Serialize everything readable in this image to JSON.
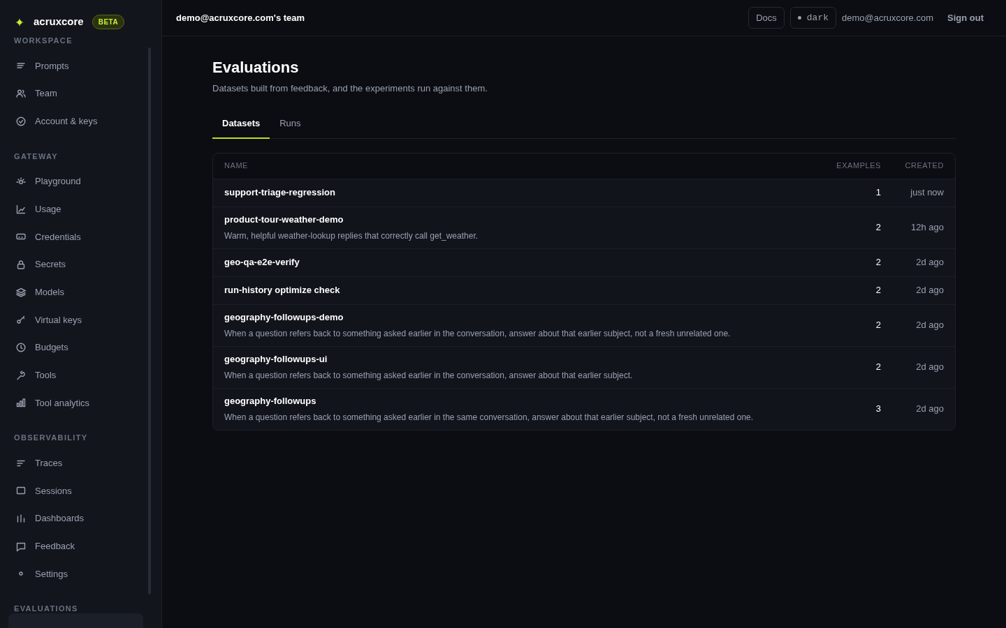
{
  "brand": {
    "name": "acruxcore",
    "badge": "BETA"
  },
  "sidebar": {
    "sections": [
      {
        "title": "WORKSPACE",
        "items": [
          {
            "label": "Prompts"
          },
          {
            "label": "Team"
          },
          {
            "label": "Account & keys"
          }
        ]
      },
      {
        "title": "GATEWAY",
        "items": [
          {
            "label": "Playground"
          },
          {
            "label": "Usage"
          },
          {
            "label": "Credentials"
          },
          {
            "label": "Secrets"
          },
          {
            "label": "Models"
          },
          {
            "label": "Virtual keys"
          },
          {
            "label": "Budgets"
          },
          {
            "label": "Tools"
          },
          {
            "label": "Tool analytics"
          }
        ]
      },
      {
        "title": "OBSERVABILITY",
        "items": [
          {
            "label": "Traces"
          },
          {
            "label": "Sessions"
          },
          {
            "label": "Dashboards"
          },
          {
            "label": "Feedback"
          },
          {
            "label": "Settings"
          }
        ]
      },
      {
        "title": "EVALUATIONS"
      }
    ]
  },
  "topbar": {
    "team": "demo@acruxcore.com's team",
    "docs": "Docs",
    "theme": "dark",
    "email": "demo@acruxcore.com",
    "sign_out": "Sign out"
  },
  "page": {
    "title": "Evaluations",
    "subtitle": "Datasets built from feedback, and the experiments run against them."
  },
  "tabs": [
    {
      "label": "Datasets",
      "selected": true
    },
    {
      "label": "Runs",
      "selected": false
    }
  ],
  "table": {
    "columns": [
      "NAME",
      "EXAMPLES",
      "CREATED"
    ],
    "rows": [
      {
        "name": "support-triage-regression",
        "examples": "1",
        "created": "just now"
      },
      {
        "name": "product-tour-weather-demo",
        "description": "Warm, helpful weather-lookup replies that correctly call get_weather.",
        "examples": "2",
        "created": "12h ago"
      },
      {
        "name": "geo-qa-e2e-verify",
        "examples": "2",
        "created": "2d ago"
      },
      {
        "name": "run-history optimize check",
        "examples": "2",
        "created": "2d ago"
      },
      {
        "name": "geography-followups-demo",
        "description": "When a question refers back to something asked earlier in the conversation, answer about that earlier subject, not a fresh unrelated one.",
        "examples": "2",
        "created": "2d ago"
      },
      {
        "name": "geography-followups-ui",
        "description": "When a question refers back to something asked earlier in the conversation, answer about that earlier subject.",
        "examples": "2",
        "created": "2d ago"
      },
      {
        "name": "geography-followups",
        "description": "When a question refers back to something asked earlier in the same conversation, answer about that earlier subject, not a fresh unrelated one.",
        "examples": "3",
        "created": "2d ago"
      }
    ]
  }
}
